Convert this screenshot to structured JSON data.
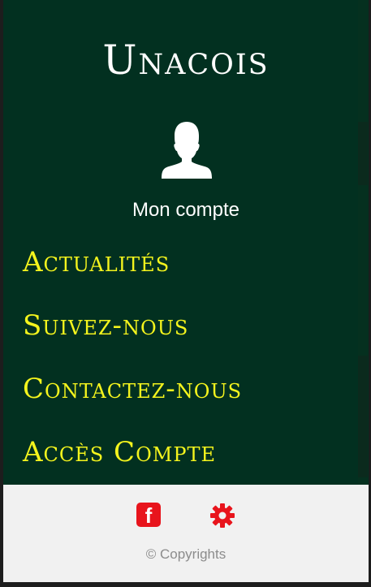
{
  "app": {
    "title": "Unacois"
  },
  "account": {
    "label": "Mon compte",
    "icon": "user-icon"
  },
  "menu": {
    "items": [
      {
        "label": "Actualités"
      },
      {
        "label": "Suivez-nous"
      },
      {
        "label": "Contactez-nous"
      },
      {
        "label": "Accès Compte"
      }
    ]
  },
  "footer": {
    "facebook_icon": "facebook-icon",
    "facebook_glyph": "f",
    "settings_icon": "gear-icon",
    "copyright": "© Copyrights"
  },
  "colors": {
    "drawer_bg": "#023020",
    "menu_text": "#f4f41d",
    "footer_bg": "#f1f1f1",
    "icon_red": "#e8141c"
  }
}
